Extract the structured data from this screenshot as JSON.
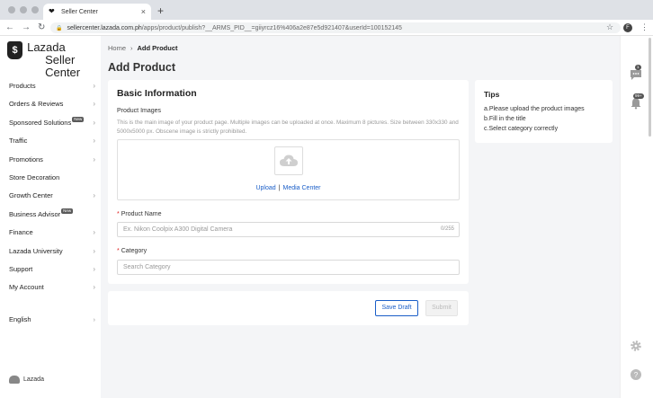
{
  "browser": {
    "tab_title": "Seller Center",
    "url_host": "sellercenter.lazada.com.ph",
    "url_path": "/apps/product/publish?__ARMS_PID__=giiyrcz16%406a2e87e5d921407&userId=100152145",
    "profile_initial": "F"
  },
  "brand": {
    "line1": "Lazada",
    "line2": "Seller Center",
    "footer": "Lazada"
  },
  "sidebar": {
    "items": [
      {
        "label": "Products",
        "badge": ""
      },
      {
        "label": "Orders & Reviews",
        "badge": ""
      },
      {
        "label": "Sponsored Solutions",
        "badge": "New"
      },
      {
        "label": "Traffic",
        "badge": ""
      },
      {
        "label": "Promotions",
        "badge": ""
      },
      {
        "label": "Store Decoration",
        "badge": ""
      },
      {
        "label": "Growth Center",
        "badge": ""
      },
      {
        "label": "Business Advisor",
        "badge": "New"
      },
      {
        "label": "Finance",
        "badge": ""
      },
      {
        "label": "Lazada University",
        "badge": ""
      },
      {
        "label": "Support",
        "badge": ""
      },
      {
        "label": "My Account",
        "badge": ""
      }
    ],
    "language": "English"
  },
  "breadcrumb": {
    "home": "Home",
    "current": "Add Product"
  },
  "page_title": "Add Product",
  "basic_info": {
    "heading": "Basic Information",
    "images_label": "Product Images",
    "images_desc": "This is the main image of your product page. Multiple images can be uploaded at once. Maximum 8 pictures. Size between 330x330 and 5000x5000 px. Obscene image is strictly prohibited.",
    "upload_link": "Upload",
    "divider": "|",
    "media_link": "Media Center",
    "name_label": "Product Name",
    "name_placeholder": "Ex. Nikon Coolpix A300 Digital Camera",
    "name_count": "0/255",
    "category_label": "Category",
    "category_placeholder": "Search Category"
  },
  "actions": {
    "save_draft": "Save Draft",
    "submit": "Submit"
  },
  "tips": {
    "heading": "Tips",
    "items": [
      "a.Please upload the product images",
      "b.Fill in the title",
      "c.Select category correctly"
    ]
  },
  "rail": {
    "chat_badge": "1",
    "notif_badge": "99+"
  },
  "colors": {
    "accent": "#1a5ec8",
    "required": "#e02020"
  }
}
